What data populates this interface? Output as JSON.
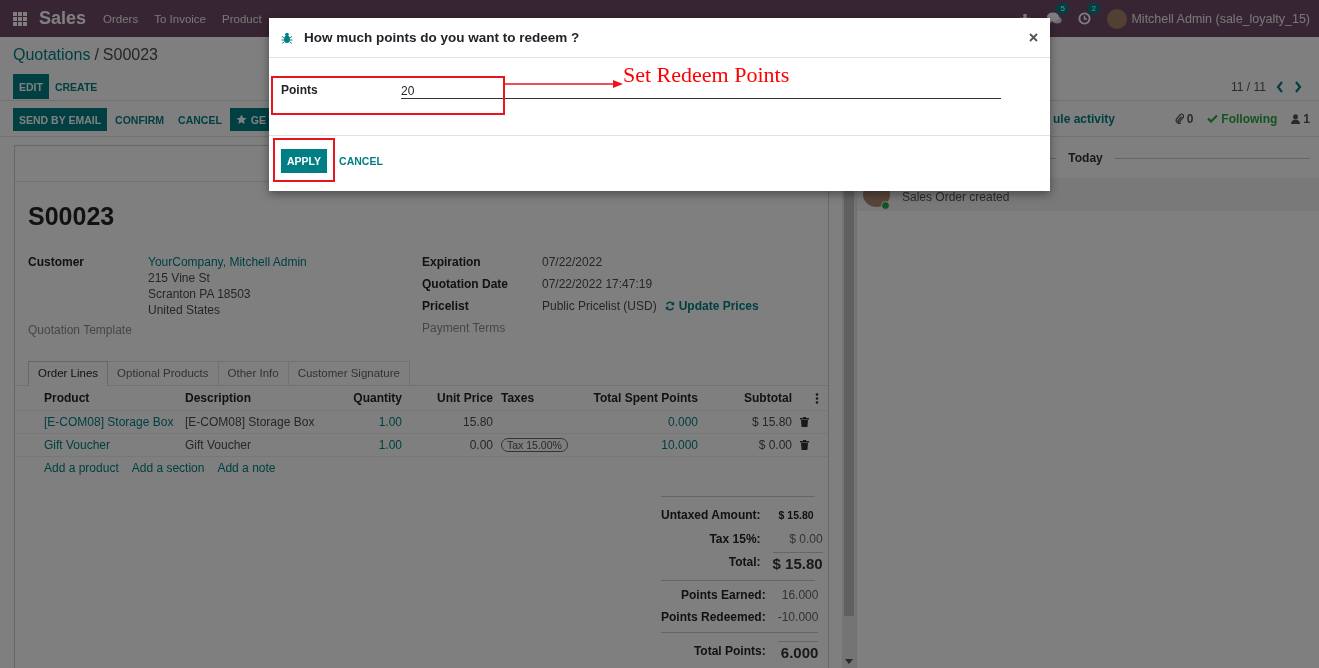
{
  "navbar": {
    "app": "Sales",
    "menu": [
      "Orders",
      "To Invoice",
      "Product"
    ],
    "messages_count": "5",
    "activities_count": "2",
    "user": "Mitchell Admin (sale_loyalty_15)"
  },
  "breadcrumb": {
    "parent": "Quotations",
    "separator": "/",
    "current": "S00023"
  },
  "actions": [
    {
      "label": "EDIT",
      "kind": "primary"
    },
    {
      "label": "CREATE",
      "kind": "link"
    }
  ],
  "pager": "11 / 11",
  "status_buttons": [
    {
      "label": "SEND BY EMAIL",
      "kind": "primary"
    },
    {
      "label": "CONFIRM",
      "kind": "link"
    },
    {
      "label": "CANCEL",
      "kind": "link"
    },
    {
      "label": "GE",
      "kind": "starred"
    }
  ],
  "form": {
    "title": "S00023",
    "left_fields": [
      {
        "label": "Customer",
        "kind": "address",
        "lines": [
          "YourCompany, Mitchell Admin",
          "215 Vine St",
          "Scranton PA 18503",
          "United States"
        ]
      },
      {
        "label": "Quotation Template",
        "kind": "empty"
      }
    ],
    "right_fields": [
      {
        "label": "Expiration",
        "kind": "text",
        "value": "07/22/2022"
      },
      {
        "label": "Quotation Date",
        "kind": "text",
        "value": "07/22/2022 17:47:19"
      },
      {
        "label": "Pricelist",
        "kind": "text",
        "value": "Public Pricelist (USD)",
        "action": "Update Prices"
      },
      {
        "label": "Payment Terms",
        "kind": "empty"
      }
    ],
    "tabs": [
      {
        "label": "Order Lines",
        "selected": true
      },
      {
        "label": "Optional Products",
        "selected": false
      },
      {
        "label": "Other Info",
        "selected": false
      },
      {
        "label": "Customer Signature",
        "selected": false
      }
    ],
    "table": {
      "columns": [
        "Product",
        "Description",
        "Quantity",
        "Unit Price",
        "Taxes",
        "Total Spent Points",
        "Subtotal"
      ],
      "rows": [
        {
          "product": "[E-COM08] Storage Box",
          "description": "[E-COM08] Storage Box",
          "quantity": "1.00",
          "unit_price": "15.80",
          "spent_points": "0.000",
          "subtotal": "$ 15.80"
        },
        {
          "product": "Gift Voucher",
          "description": "Gift Voucher",
          "quantity": "1.00",
          "unit_price": "0.00",
          "taxes": "Tax 15.00%",
          "spent_points": "10.000",
          "subtotal": "$ 0.00"
        }
      ],
      "add_links": [
        "Add a product",
        "Add a section",
        "Add a note"
      ]
    },
    "totals": [
      {
        "label": "Untaxed Amount:",
        "value": "$ 15.80",
        "kind": "bold"
      },
      {
        "label": "Tax 15%:",
        "value": "$ 0.00",
        "kind": "plain"
      },
      {
        "label": "Total:",
        "value": "$ 15.80",
        "kind": "grand"
      }
    ],
    "points": [
      {
        "label": "Points Earned:",
        "value": "16.000",
        "kind": "plain"
      },
      {
        "label": "Points Redeemed:",
        "value": "-10.000",
        "kind": "plain"
      },
      {
        "label": "Total Points:",
        "value": "6.000",
        "kind": "grand"
      }
    ]
  },
  "chatter": {
    "activity_link": "ule activity",
    "attachments": "0",
    "follow": "Following",
    "followers": "1",
    "separator": "Today",
    "messages": [
      {
        "body": "Sales Order created"
      }
    ]
  },
  "dialog": {
    "title": "How much points do you want to redeem ?",
    "field": {
      "label": "Points",
      "value": "20"
    },
    "buttons": [
      {
        "label": "APPLY",
        "kind": "primary"
      },
      {
        "label": "CANCEL",
        "kind": "link"
      }
    ]
  },
  "annotation": {
    "label": "Set Redeem Points"
  }
}
